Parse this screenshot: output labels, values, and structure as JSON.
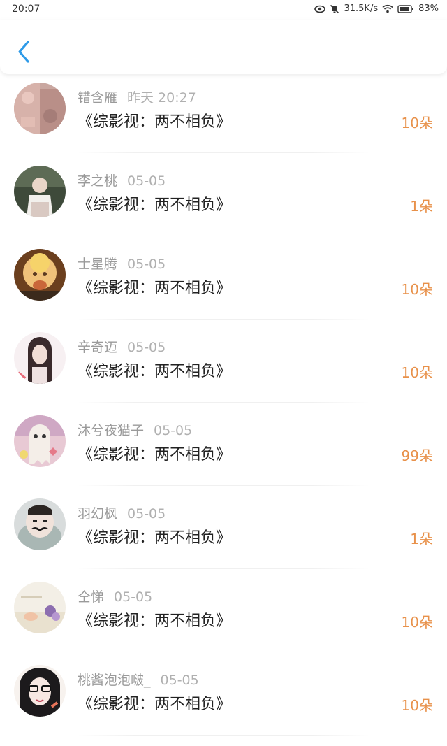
{
  "status_bar": {
    "time": "20:07",
    "network_speed": "31.5K/s",
    "battery": "83%",
    "icons": [
      "eye-icon",
      "mute-bell-icon",
      "wifi-icon",
      "battery-icon"
    ]
  },
  "header": {
    "back_icon": "chevron-left-icon",
    "accent_color": "#2d9ae8"
  },
  "colors": {
    "count": "#e8914a",
    "name": "#9a9a9a",
    "title": "#222222"
  },
  "rows": [
    {
      "name": "错含雁",
      "date": "昨天 20:27",
      "title": "《综影视：两不相负》",
      "count": "10朵"
    },
    {
      "name": "李之桃",
      "date": "05-05",
      "title": "《综影视：两不相负》",
      "count": "1朵"
    },
    {
      "name": "士星腾",
      "date": "05-05",
      "title": "《综影视：两不相负》",
      "count": "10朵"
    },
    {
      "name": "辛奇迈",
      "date": "05-05",
      "title": "《综影视：两不相负》",
      "count": "10朵"
    },
    {
      "name": "沐兮夜猫子",
      "date": "05-05",
      "title": "《综影视：两不相负》",
      "count": "99朵"
    },
    {
      "name": "羽幻枫",
      "date": "05-05",
      "title": "《综影视：两不相负》",
      "count": "1朵"
    },
    {
      "name": "仝悌",
      "date": "05-05",
      "title": "《综影视：两不相负》",
      "count": "10朵"
    },
    {
      "name": "桃酱泡泡啵_",
      "date": "05-05",
      "title": "《综影视：两不相负》",
      "count": "10朵"
    }
  ]
}
